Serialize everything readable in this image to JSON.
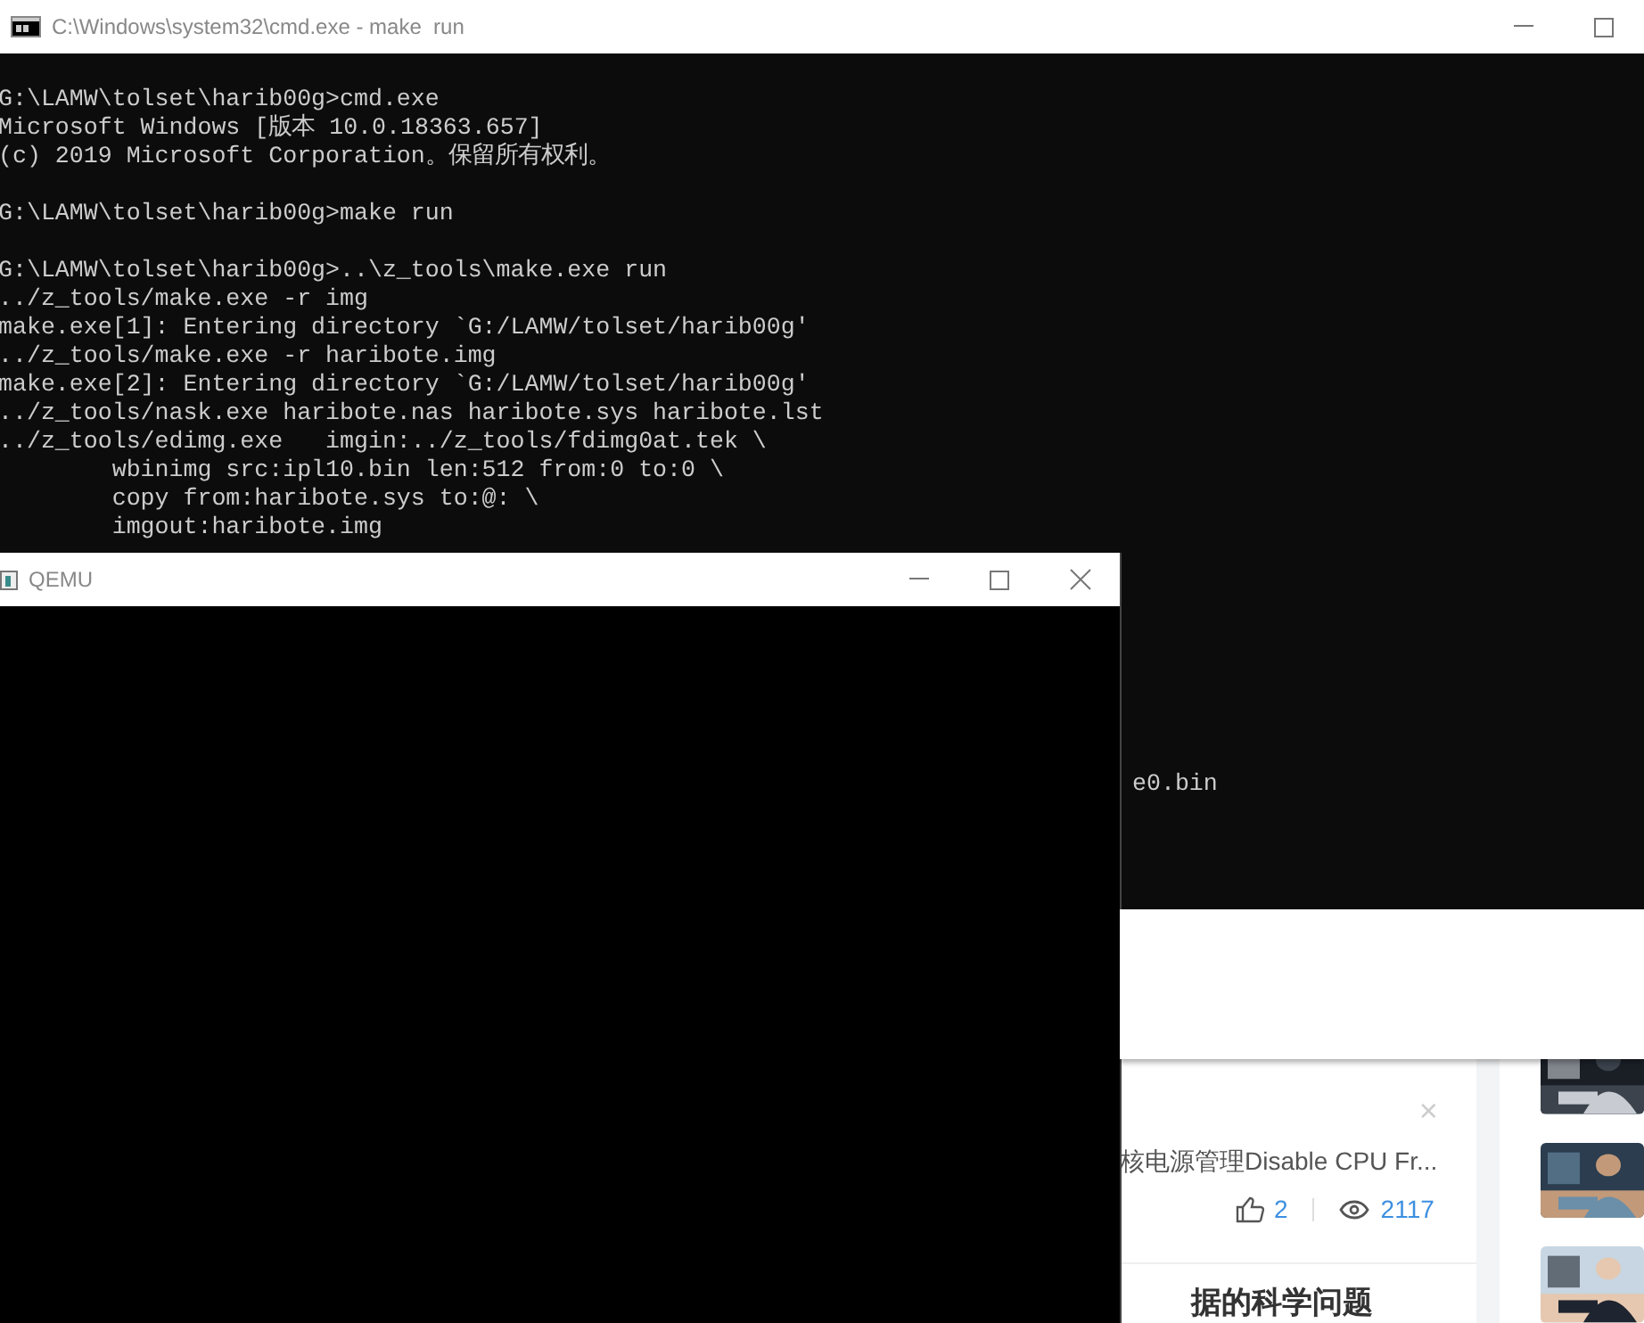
{
  "background_page": {
    "article": {
      "title": "核电源管理Disable CPU Fr...",
      "likes": "2",
      "views": "2117",
      "close": "×"
    },
    "next_title": "据的科学问题"
  },
  "console_window": {
    "title": "C:\\Windows\\system32\\cmd.exe - make  run",
    "controls": [
      {
        "kind": "minimize"
      },
      {
        "kind": "maximize"
      }
    ],
    "lines": [
      {
        "kind": "text",
        "text": "G:\\LAMW\\tolset\\harib00g>cmd.exe"
      },
      {
        "kind": "text",
        "text": "Microsoft Windows [版本 10.0.18363.657]"
      },
      {
        "kind": "text",
        "text": "(c) 2019 Microsoft Corporation。保留所有权利。"
      },
      {
        "kind": "blank"
      },
      {
        "kind": "text",
        "text": "G:\\LAMW\\tolset\\harib00g>make run"
      },
      {
        "kind": "blank"
      },
      {
        "kind": "text",
        "text": "G:\\LAMW\\tolset\\harib00g>..\\z_tools\\make.exe run"
      },
      {
        "kind": "text",
        "text": "../z_tools/make.exe -r img"
      },
      {
        "kind": "text",
        "text": "make.exe[1]: Entering directory `G:/LAMW/tolset/harib00g'"
      },
      {
        "kind": "text",
        "text": "../z_tools/make.exe -r haribote.img"
      },
      {
        "kind": "text",
        "text": "make.exe[2]: Entering directory `G:/LAMW/tolset/harib00g'"
      },
      {
        "kind": "text",
        "text": "../z_tools/nask.exe haribote.nas haribote.sys haribote.lst"
      },
      {
        "kind": "text",
        "text": "../z_tools/edimg.exe   imgin:../z_tools/fdimg0at.tek \\"
      },
      {
        "kind": "text",
        "text": "        wbinimg src:ipl10.bin len:512 from:0 to:0 \\"
      },
      {
        "kind": "text",
        "text": "        copy from:haribote.sys to:@: \\"
      },
      {
        "kind": "text",
        "text": "        imgout:haribote.img"
      },
      {
        "kind": "hidden"
      },
      {
        "kind": "hidden"
      },
      {
        "kind": "hidden"
      },
      {
        "kind": "hidden"
      },
      {
        "kind": "hidden"
      },
      {
        "kind": "hidden"
      },
      {
        "kind": "hidden"
      },
      {
        "kind": "hidden"
      },
      {
        "kind": "tail",
        "text": "e0.bin"
      }
    ]
  },
  "qemu_window": {
    "title": "QEMU",
    "controls": [
      {
        "kind": "minimize"
      },
      {
        "kind": "maximize"
      },
      {
        "kind": "close"
      }
    ]
  }
}
